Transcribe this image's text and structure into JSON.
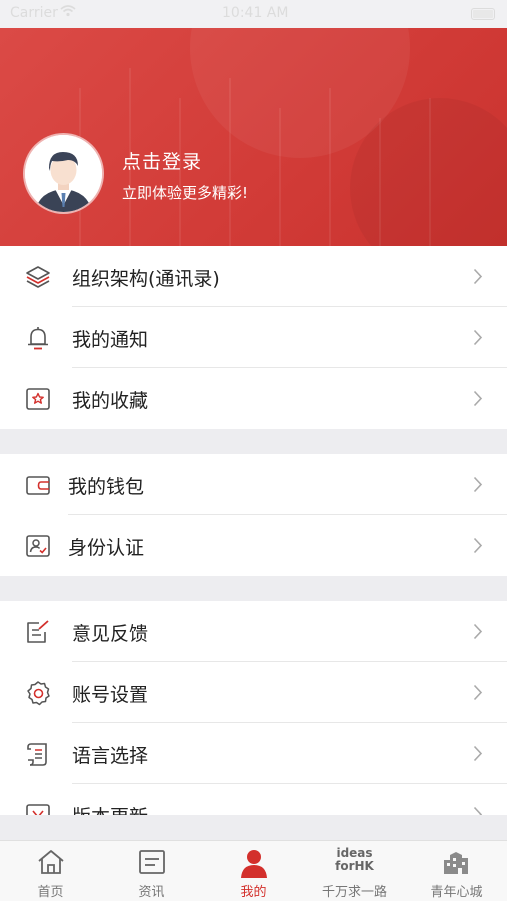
{
  "status_bar": {
    "carrier": "Carrier",
    "time": "10:41 AM"
  },
  "profile": {
    "login_title": "点击登录",
    "login_subtitle": "立即体验更多精彩!"
  },
  "menu_group_1": [
    {
      "label": "组织架构(通讯录)",
      "icon": "layers-icon"
    },
    {
      "label": "我的通知",
      "icon": "bell-icon"
    },
    {
      "label": "我的收藏",
      "icon": "star-box-icon"
    }
  ],
  "menu_group_2": [
    {
      "label": "我的钱包",
      "icon": "wallet-icon"
    },
    {
      "label": "身份认证",
      "icon": "id-verify-icon"
    }
  ],
  "menu_group_3": [
    {
      "label": "意见反馈",
      "icon": "feedback-edit-icon"
    },
    {
      "label": "账号设置",
      "icon": "gear-icon"
    },
    {
      "label": "语言选择",
      "icon": "scroll-document-icon"
    },
    {
      "label": "版本更新",
      "icon": "version-update-icon"
    }
  ],
  "tabbar": [
    {
      "label": "首页",
      "icon": "home-icon",
      "active": false
    },
    {
      "label": "资讯",
      "icon": "news-icon",
      "active": false
    },
    {
      "label": "我的",
      "icon": "person-icon",
      "active": true
    },
    {
      "label": "千万求一路",
      "icon": "ideas-for-hk-logo",
      "logo_text": "ideas forHK",
      "active": false
    },
    {
      "label": "青年心城",
      "icon": "city-building-icon",
      "active": false
    }
  ],
  "colors": {
    "brand_red": "#d3302c",
    "background": "#ededf0"
  }
}
